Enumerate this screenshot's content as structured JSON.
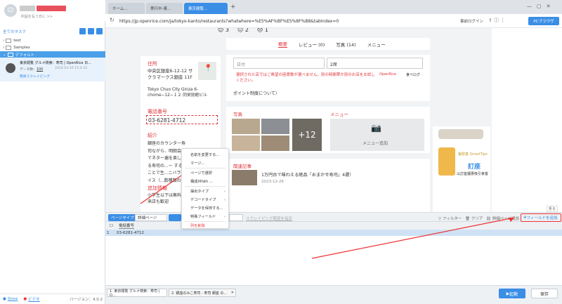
{
  "sidebar": {
    "subtitle": "利益を払う日に >>",
    "tasks_title": "全てのタスク",
    "folders": [
      "test",
      "Samples",
      "デフォルト"
    ],
    "task": {
      "title": "東京閲覧 グルメ検索：寿司 | OpenRice 日...",
      "data_label": "データ数：",
      "data_count": "100",
      "date": "2024-03-10 15:4:33",
      "tag": "簡易スクレイピング"
    },
    "foot": {
      "store": "Store",
      "video": "ビデオ",
      "version": "バージョン：4.0.2"
    }
  },
  "tabs": [
    "ホーム...",
    "実行中-東...",
    "東京閲覧..."
  ],
  "url": "https://jp.openrice.com/ja/tokyo-kanto/restaurants?whatwhere=%E5%AF%BF%E5%8F%B8&tabIndex=0",
  "login": "事前ログイン",
  "pc_browser": "PCブラウザ",
  "page": {
    "counts": [
      "3",
      "2",
      "1"
    ],
    "nav": [
      "概要",
      "レビュー (0)",
      "写真 (14)",
      "メニュー"
    ],
    "address_title": "住所",
    "address_jp": "中央区銀座6-12-12 サクラマークス銀座 11F",
    "address_en": "Tokyo Chuo City Ginza 6-chome−12−１２ 同栄別館ビル",
    "phone_title": "電話番号",
    "phone": "03-6281-4712",
    "intro_title": "紹介",
    "intro": "銀座のカウンター寿司ながら、明朗会計でネタ一遍を楽しめる寿司の...ー するこことで生...ニバラダイス（...数種類の雲丹を...箱も見てくれる...",
    "extra_title": "追加情報",
    "extra": "小学生以下は無料... 来店も歓迎",
    "date_placeholder": "日付",
    "people": "2席",
    "warning": "選択された店ではご希望の座席数が選べません。別の時間帯か別のお店をお試しください。",
    "point_link": "ポイント制度について〉",
    "photo_title": "写真",
    "photo_more": "+12",
    "menu_title": "メニュー",
    "menu_add": "メニュー追加",
    "article_title": "関連記事",
    "article_text": "1万円台で味わえる絶品「おまかせ寿司」4選！",
    "article_date": "2023-12-26",
    "ad_title": "餐飲業 SmartTips",
    "ad_sub1": "訂座",
    "ad_sub2": "以訂座優惠吸引食客",
    "openrice": "OpenRice",
    "tabelog": "食べログ"
  },
  "toolbar": {
    "page_type": "ページタイプ",
    "detail": "詳細ページ",
    "filter": "フィルター",
    "clear": "クリア",
    "detail_link": "詳細ページ追加",
    "add_field": "フィールドを追加",
    "fold": "折る",
    "scrape_hint": "スクレイピング範囲を指定"
  },
  "grid": {
    "header": "電話番号",
    "row_no": "1",
    "row_val": "03-6281-4712"
  },
  "bottom": {
    "tab1": "1. 東京閲覧 グルメ検索：寿司 | O...",
    "tab2": "2. 銀座のみこ寿司 - 寿司 銀座 の...",
    "run": "起動",
    "save": "保存"
  },
  "menu": {
    "items": [
      "名前を変更する...",
      "マージ...",
      "ページで選択",
      "構成XPath ...",
      "抽出タイプ",
      "デコードタイプ",
      "データを保存する...",
      "特殊フィールド",
      "列を削除"
    ]
  }
}
